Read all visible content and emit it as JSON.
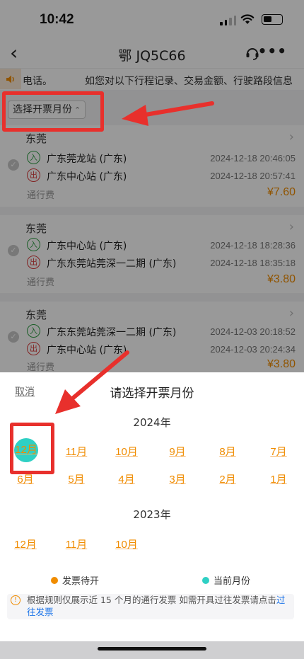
{
  "status": {
    "time": "10:42"
  },
  "nav": {
    "title": "鄂 JQ5C66"
  },
  "notice": {
    "text_left": "电话。",
    "text_right": "如您对以下行程记录、交易金额、行驶路段信息"
  },
  "filter": {
    "label": "选择开票月份"
  },
  "trips": [
    {
      "city": "东莞",
      "entry": {
        "station": "广东莞龙站 (广东)",
        "time": "2024-12-18 20:46:05"
      },
      "exit": {
        "station": "广东中心站 (广东)",
        "time": "2024-12-18 20:57:41"
      },
      "fee_label": "通行费",
      "amount": "¥7.60"
    },
    {
      "city": "东莞",
      "entry": {
        "station": "广东中心站 (广东)",
        "time": "2024-12-18 18:28:36"
      },
      "exit": {
        "station": "广东东莞站莞深一二期 (广东)",
        "time": "2024-12-18 18:35:18"
      },
      "fee_label": "通行费",
      "amount": "¥3.80"
    },
    {
      "city": "东莞",
      "entry": {
        "station": "广东东莞站莞深一二期 (广东)",
        "time": "2024-12-03 20:18:52"
      },
      "exit": {
        "station": "广东中心站 (广东)",
        "time": "2024-12-03 20:24:34"
      },
      "fee_label": "通行费",
      "amount": "¥3.80"
    }
  ],
  "badges": {
    "in": "入",
    "out": "出"
  },
  "sheet": {
    "cancel": "取消",
    "title": "请选择开票月份",
    "years": [
      {
        "label": "2024年",
        "months": [
          "12月",
          "11月",
          "10月",
          "9月",
          "8月",
          "7月",
          "6月",
          "5月",
          "4月",
          "3月",
          "2月",
          "1月"
        ],
        "current": "12月"
      },
      {
        "label": "2023年",
        "months": [
          "12月",
          "11月",
          "10月"
        ]
      }
    ],
    "legend": [
      {
        "label": "发票待开",
        "color": "#f08c00"
      },
      {
        "label": "当前月份",
        "color": "#2fd0c4"
      }
    ],
    "tip": {
      "text": "根据规则仅展示近 15 个月的通行发票 如需开具过往发票请点击",
      "link": "过往发票"
    }
  },
  "colors": {
    "accent": "#f08c00",
    "current": "#2fd0c4",
    "annotation": "#e8302c"
  }
}
